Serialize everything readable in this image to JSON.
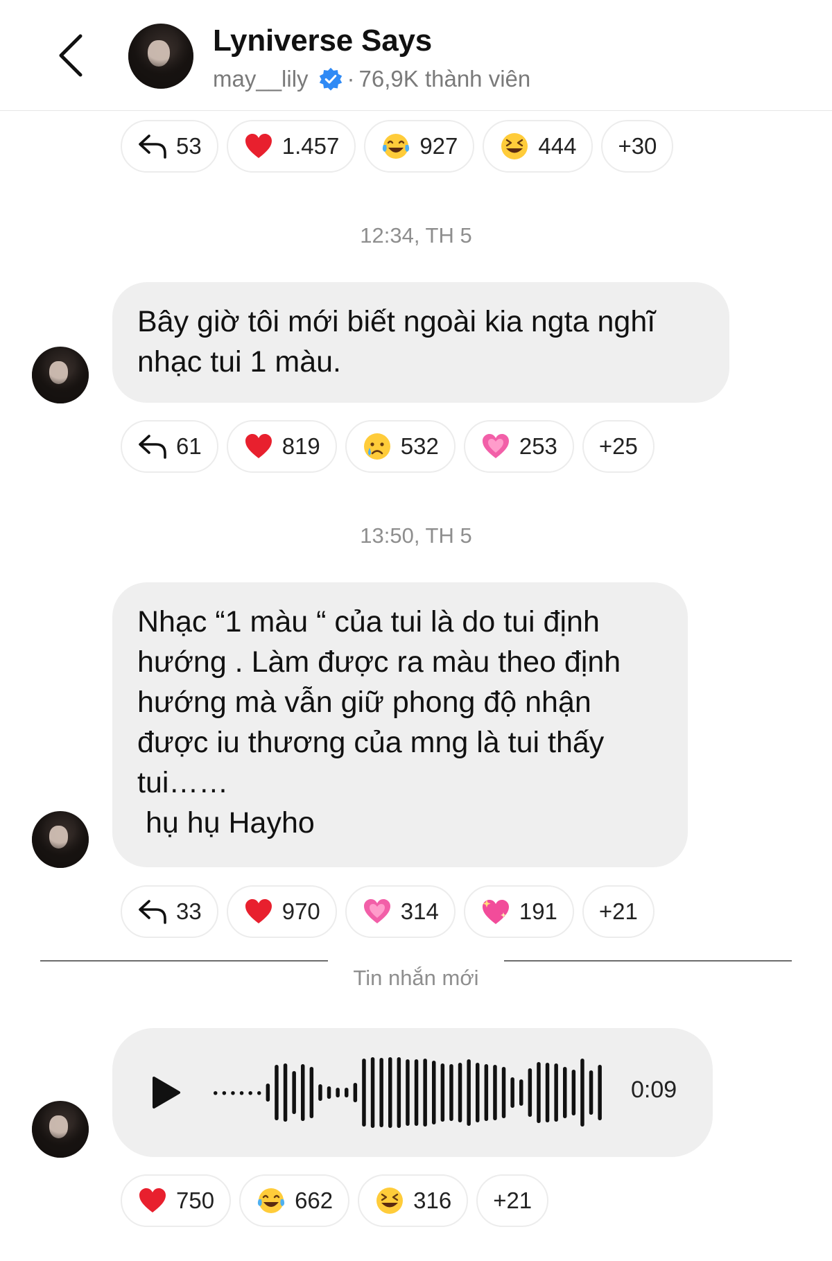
{
  "header": {
    "title": "Lyniverse Says",
    "username": "may__lily",
    "separator": "·",
    "members": "76,9K thành viên"
  },
  "messages": [
    {
      "reactions": [
        {
          "icon": "reply-icon",
          "count": "53"
        },
        {
          "icon": "red-heart-icon",
          "count": "1.457"
        },
        {
          "icon": "tears-of-joy-icon",
          "count": "927"
        },
        {
          "icon": "grinning-squint-icon",
          "count": "444"
        },
        {
          "icon": "",
          "count": "+30"
        }
      ]
    },
    {
      "timestamp": "12:34, TH 5",
      "text": "Bây giờ tôi mới biết ngoài kia ngta nghĩ\nnhạc tui 1 màu.",
      "reactions": [
        {
          "icon": "reply-icon",
          "count": "61"
        },
        {
          "icon": "red-heart-icon",
          "count": "819"
        },
        {
          "icon": "crying-face-icon",
          "count": "532"
        },
        {
          "icon": "growing-heart-icon",
          "count": "253"
        },
        {
          "icon": "",
          "count": "+25"
        }
      ]
    },
    {
      "timestamp": "13:50, TH 5",
      "text": "Nhạc “1 màu “ của tui là do tui định\nhướng . Làm được ra màu theo định\nhướng mà vẫn giữ phong độ nhận\nđược iu thương của mng là tui thấy\ntui……\n hụ hụ Hayho",
      "reactions": [
        {
          "icon": "reply-icon",
          "count": "33"
        },
        {
          "icon": "red-heart-icon",
          "count": "970"
        },
        {
          "icon": "growing-heart-icon",
          "count": "314"
        },
        {
          "icon": "sparkling-heart-icon",
          "count": "191"
        },
        {
          "icon": "",
          "count": "+21"
        }
      ]
    }
  ],
  "divider_label": "Tin nhắn mới",
  "voice_message": {
    "duration": "0:09",
    "reactions": [
      {
        "icon": "red-heart-icon",
        "count": "750"
      },
      {
        "icon": "tears-of-joy-icon",
        "count": "662"
      },
      {
        "icon": "grinning-squint-icon",
        "count": "316"
      },
      {
        "icon": "",
        "count": "+21"
      }
    ]
  },
  "colors": {
    "bubble": "#efefef",
    "verified": "#2f8af5",
    "muted_text": "#8e8e8e"
  }
}
